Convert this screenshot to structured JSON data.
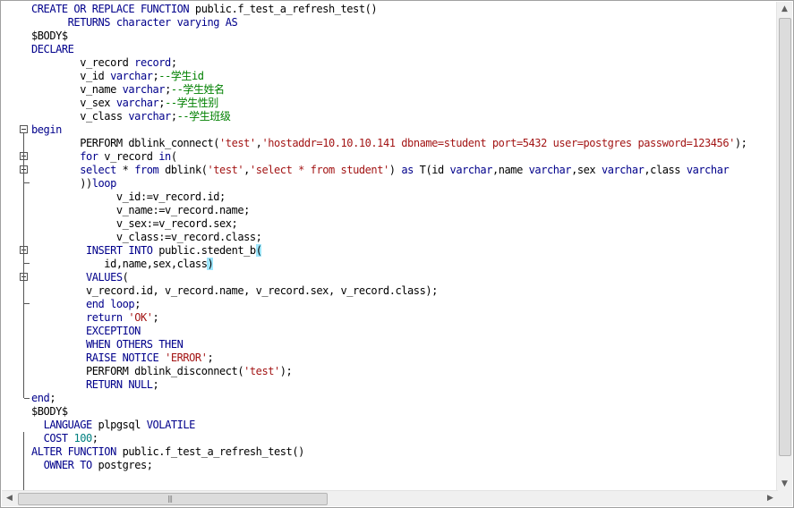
{
  "editor": {
    "lines": [
      [
        {
          "t": "CREATE OR REPLACE FUNCTION",
          "c": "kw"
        },
        {
          "t": " public.f_test_a_refresh_test()"
        }
      ],
      [
        {
          "t": "      RETURNS character varying AS",
          "c": "kw"
        }
      ],
      [
        {
          "t": "$BODY$"
        }
      ],
      [
        {
          "t": "DECLARE",
          "c": "kw"
        }
      ],
      [
        {
          "t": "        v_record "
        },
        {
          "t": "record",
          "c": "kw"
        },
        {
          "t": ";"
        }
      ],
      [
        {
          "t": "        v_id "
        },
        {
          "t": "varchar",
          "c": "kw"
        },
        {
          "t": ";"
        },
        {
          "t": "--学生id",
          "c": "cm"
        }
      ],
      [
        {
          "t": "        v_name "
        },
        {
          "t": "varchar",
          "c": "kw"
        },
        {
          "t": ";"
        },
        {
          "t": "--学生姓名",
          "c": "cm"
        }
      ],
      [
        {
          "t": "        v_sex "
        },
        {
          "t": "varchar",
          "c": "kw"
        },
        {
          "t": ";"
        },
        {
          "t": "--学生性别",
          "c": "cm"
        }
      ],
      [
        {
          "t": "        v_class "
        },
        {
          "t": "varchar",
          "c": "kw"
        },
        {
          "t": ";"
        },
        {
          "t": "--学生班级",
          "c": "cm"
        }
      ],
      [
        {
          "t": "begin",
          "c": "kw"
        }
      ],
      [
        {
          "t": "        PERFORM dblink_connect("
        },
        {
          "t": "'test'",
          "c": "str"
        },
        {
          "t": ","
        },
        {
          "t": "'hostaddr=10.10.10.141 dbname=student port=5432 user=postgres password=123456'",
          "c": "str"
        },
        {
          "t": ");"
        }
      ],
      [
        {
          "t": "        "
        },
        {
          "t": "for",
          "c": "kw"
        },
        {
          "t": " v_record "
        },
        {
          "t": "in",
          "c": "kw"
        },
        {
          "t": "("
        }
      ],
      [
        {
          "t": "        "
        },
        {
          "t": "select",
          "c": "kw"
        },
        {
          "t": " * "
        },
        {
          "t": "from",
          "c": "kw"
        },
        {
          "t": " dblink("
        },
        {
          "t": "'test'",
          "c": "str"
        },
        {
          "t": ","
        },
        {
          "t": "'select * from student'",
          "c": "str"
        },
        {
          "t": ") "
        },
        {
          "t": "as",
          "c": "kw"
        },
        {
          "t": " T(id "
        },
        {
          "t": "varchar",
          "c": "kw"
        },
        {
          "t": ",name "
        },
        {
          "t": "varchar",
          "c": "kw"
        },
        {
          "t": ",sex "
        },
        {
          "t": "varchar",
          "c": "kw"
        },
        {
          "t": ",class "
        },
        {
          "t": "varchar",
          "c": "kw"
        }
      ],
      [
        {
          "t": "        ))"
        },
        {
          "t": "loop",
          "c": "kw"
        }
      ],
      [
        {
          "t": "              v_id:=v_record.id;"
        }
      ],
      [
        {
          "t": "              v_name:=v_record.name;"
        }
      ],
      [
        {
          "t": "              v_sex:=v_record.sex;"
        }
      ],
      [
        {
          "t": "              v_class:=v_record.class;"
        }
      ],
      [
        {
          "t": "         "
        },
        {
          "t": "INSERT INTO",
          "c": "kw"
        },
        {
          "t": " public.stedent_b"
        },
        {
          "t": "(",
          "c": "hl"
        }
      ],
      [
        {
          "t": "            id,name,sex,class"
        },
        {
          "t": ")",
          "c": "hl"
        }
      ],
      [
        {
          "t": "         "
        },
        {
          "t": "VALUES",
          "c": "kw"
        },
        {
          "t": "("
        }
      ],
      [
        {
          "t": "         v_record.id, v_record.name, v_record.sex, v_record.class);"
        }
      ],
      [
        {
          "t": "         "
        },
        {
          "t": "end loop",
          "c": "kw"
        },
        {
          "t": ";"
        }
      ],
      [
        {
          "t": "         "
        },
        {
          "t": "return",
          "c": "kw"
        },
        {
          "t": " "
        },
        {
          "t": "'OK'",
          "c": "str"
        },
        {
          "t": ";"
        }
      ],
      [
        {
          "t": "         "
        },
        {
          "t": "EXCEPTION",
          "c": "kw"
        }
      ],
      [
        {
          "t": "         "
        },
        {
          "t": "WHEN OTHERS THEN",
          "c": "kw"
        }
      ],
      [
        {
          "t": "         "
        },
        {
          "t": "RAISE NOTICE",
          "c": "kw"
        },
        {
          "t": " "
        },
        {
          "t": "'ERROR'",
          "c": "str"
        },
        {
          "t": ";"
        }
      ],
      [
        {
          "t": "         PERFORM dblink_disconnect("
        },
        {
          "t": "'test'",
          "c": "str"
        },
        {
          "t": ");"
        }
      ],
      [
        {
          "t": "         "
        },
        {
          "t": "RETURN NULL",
          "c": "kw"
        },
        {
          "t": ";"
        }
      ],
      [
        {
          "t": "end",
          "c": "kw"
        },
        {
          "t": ";"
        }
      ],
      [
        {
          "t": "$BODY$"
        }
      ],
      [
        {
          "t": "  "
        },
        {
          "t": "LANGUAGE",
          "c": "kw"
        },
        {
          "t": " plpgsql "
        },
        {
          "t": "VOLATILE",
          "c": "kw"
        }
      ],
      [
        {
          "t": "  "
        },
        {
          "t": "COST",
          "c": "kw"
        },
        {
          "t": " "
        },
        {
          "t": "100",
          "c": "num"
        },
        {
          "t": ";"
        }
      ],
      [
        {
          "t": "ALTER FUNCTION",
          "c": "kw"
        },
        {
          "t": " public.f_test_a_refresh_test()"
        }
      ],
      [
        {
          "t": "  "
        },
        {
          "t": "OWNER TO",
          "c": "kw"
        },
        {
          "t": " postgres;"
        }
      ]
    ]
  },
  "scrollbars": {
    "up_arrow": "▲",
    "down_arrow": "▼",
    "left_arrow": "◀",
    "right_arrow": "▶",
    "grip": "|||"
  }
}
